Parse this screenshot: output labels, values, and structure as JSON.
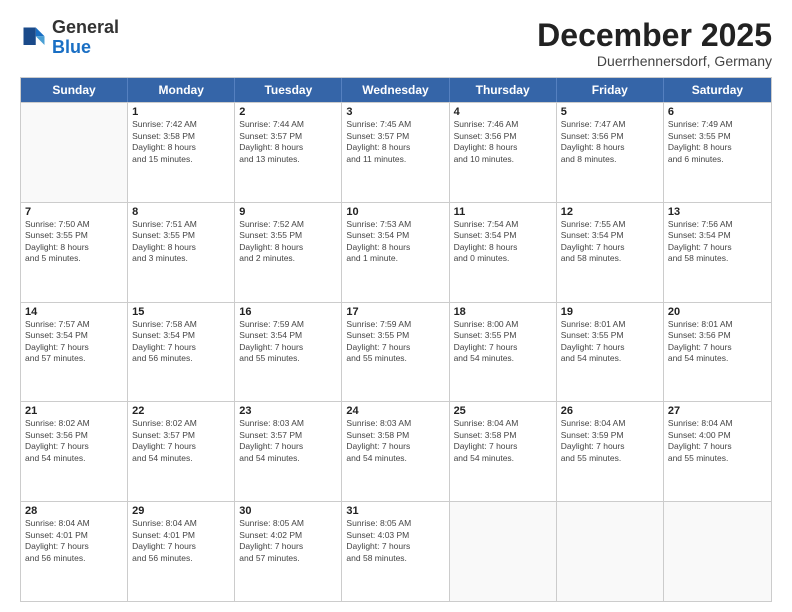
{
  "header": {
    "logo": {
      "line1": "General",
      "line2": "Blue"
    },
    "month": "December 2025",
    "location": "Duerrhennersdorf, Germany"
  },
  "weekdays": [
    "Sunday",
    "Monday",
    "Tuesday",
    "Wednesday",
    "Thursday",
    "Friday",
    "Saturday"
  ],
  "weeks": [
    [
      {
        "day": null,
        "info": null
      },
      {
        "day": "1",
        "info": "Sunrise: 7:42 AM\nSunset: 3:58 PM\nDaylight: 8 hours\nand 15 minutes."
      },
      {
        "day": "2",
        "info": "Sunrise: 7:44 AM\nSunset: 3:57 PM\nDaylight: 8 hours\nand 13 minutes."
      },
      {
        "day": "3",
        "info": "Sunrise: 7:45 AM\nSunset: 3:57 PM\nDaylight: 8 hours\nand 11 minutes."
      },
      {
        "day": "4",
        "info": "Sunrise: 7:46 AM\nSunset: 3:56 PM\nDaylight: 8 hours\nand 10 minutes."
      },
      {
        "day": "5",
        "info": "Sunrise: 7:47 AM\nSunset: 3:56 PM\nDaylight: 8 hours\nand 8 minutes."
      },
      {
        "day": "6",
        "info": "Sunrise: 7:49 AM\nSunset: 3:55 PM\nDaylight: 8 hours\nand 6 minutes."
      }
    ],
    [
      {
        "day": "7",
        "info": "Sunrise: 7:50 AM\nSunset: 3:55 PM\nDaylight: 8 hours\nand 5 minutes."
      },
      {
        "day": "8",
        "info": "Sunrise: 7:51 AM\nSunset: 3:55 PM\nDaylight: 8 hours\nand 3 minutes."
      },
      {
        "day": "9",
        "info": "Sunrise: 7:52 AM\nSunset: 3:55 PM\nDaylight: 8 hours\nand 2 minutes."
      },
      {
        "day": "10",
        "info": "Sunrise: 7:53 AM\nSunset: 3:54 PM\nDaylight: 8 hours\nand 1 minute."
      },
      {
        "day": "11",
        "info": "Sunrise: 7:54 AM\nSunset: 3:54 PM\nDaylight: 8 hours\nand 0 minutes."
      },
      {
        "day": "12",
        "info": "Sunrise: 7:55 AM\nSunset: 3:54 PM\nDaylight: 7 hours\nand 58 minutes."
      },
      {
        "day": "13",
        "info": "Sunrise: 7:56 AM\nSunset: 3:54 PM\nDaylight: 7 hours\nand 58 minutes."
      }
    ],
    [
      {
        "day": "14",
        "info": "Sunrise: 7:57 AM\nSunset: 3:54 PM\nDaylight: 7 hours\nand 57 minutes."
      },
      {
        "day": "15",
        "info": "Sunrise: 7:58 AM\nSunset: 3:54 PM\nDaylight: 7 hours\nand 56 minutes."
      },
      {
        "day": "16",
        "info": "Sunrise: 7:59 AM\nSunset: 3:54 PM\nDaylight: 7 hours\nand 55 minutes."
      },
      {
        "day": "17",
        "info": "Sunrise: 7:59 AM\nSunset: 3:55 PM\nDaylight: 7 hours\nand 55 minutes."
      },
      {
        "day": "18",
        "info": "Sunrise: 8:00 AM\nSunset: 3:55 PM\nDaylight: 7 hours\nand 54 minutes."
      },
      {
        "day": "19",
        "info": "Sunrise: 8:01 AM\nSunset: 3:55 PM\nDaylight: 7 hours\nand 54 minutes."
      },
      {
        "day": "20",
        "info": "Sunrise: 8:01 AM\nSunset: 3:56 PM\nDaylight: 7 hours\nand 54 minutes."
      }
    ],
    [
      {
        "day": "21",
        "info": "Sunrise: 8:02 AM\nSunset: 3:56 PM\nDaylight: 7 hours\nand 54 minutes."
      },
      {
        "day": "22",
        "info": "Sunrise: 8:02 AM\nSunset: 3:57 PM\nDaylight: 7 hours\nand 54 minutes."
      },
      {
        "day": "23",
        "info": "Sunrise: 8:03 AM\nSunset: 3:57 PM\nDaylight: 7 hours\nand 54 minutes."
      },
      {
        "day": "24",
        "info": "Sunrise: 8:03 AM\nSunset: 3:58 PM\nDaylight: 7 hours\nand 54 minutes."
      },
      {
        "day": "25",
        "info": "Sunrise: 8:04 AM\nSunset: 3:58 PM\nDaylight: 7 hours\nand 54 minutes."
      },
      {
        "day": "26",
        "info": "Sunrise: 8:04 AM\nSunset: 3:59 PM\nDaylight: 7 hours\nand 55 minutes."
      },
      {
        "day": "27",
        "info": "Sunrise: 8:04 AM\nSunset: 4:00 PM\nDaylight: 7 hours\nand 55 minutes."
      }
    ],
    [
      {
        "day": "28",
        "info": "Sunrise: 8:04 AM\nSunset: 4:01 PM\nDaylight: 7 hours\nand 56 minutes."
      },
      {
        "day": "29",
        "info": "Sunrise: 8:04 AM\nSunset: 4:01 PM\nDaylight: 7 hours\nand 56 minutes."
      },
      {
        "day": "30",
        "info": "Sunrise: 8:05 AM\nSunset: 4:02 PM\nDaylight: 7 hours\nand 57 minutes."
      },
      {
        "day": "31",
        "info": "Sunrise: 8:05 AM\nSunset: 4:03 PM\nDaylight: 7 hours\nand 58 minutes."
      },
      {
        "day": null,
        "info": null
      },
      {
        "day": null,
        "info": null
      },
      {
        "day": null,
        "info": null
      }
    ]
  ]
}
